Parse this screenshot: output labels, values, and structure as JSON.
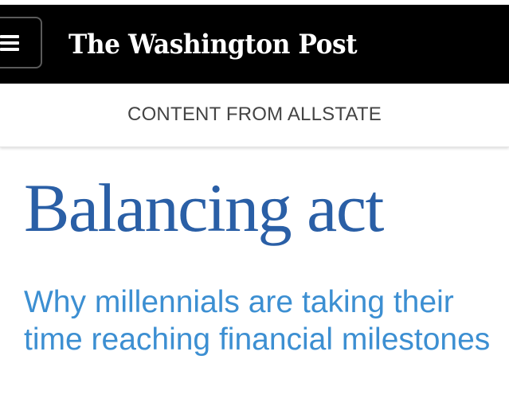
{
  "header": {
    "menu_icon": "hamburger-menu-icon",
    "masthead": "The Washington Post",
    "background_color": "#000000"
  },
  "sponsor": {
    "label": "CONTENT FROM ALLSTATE"
  },
  "article": {
    "headline": "Balancing act",
    "subheadline": "Why millennials are taking their time reaching financial milestones",
    "headline_color": "#2a5fa6",
    "subheadline_color": "#3c8fd2"
  }
}
